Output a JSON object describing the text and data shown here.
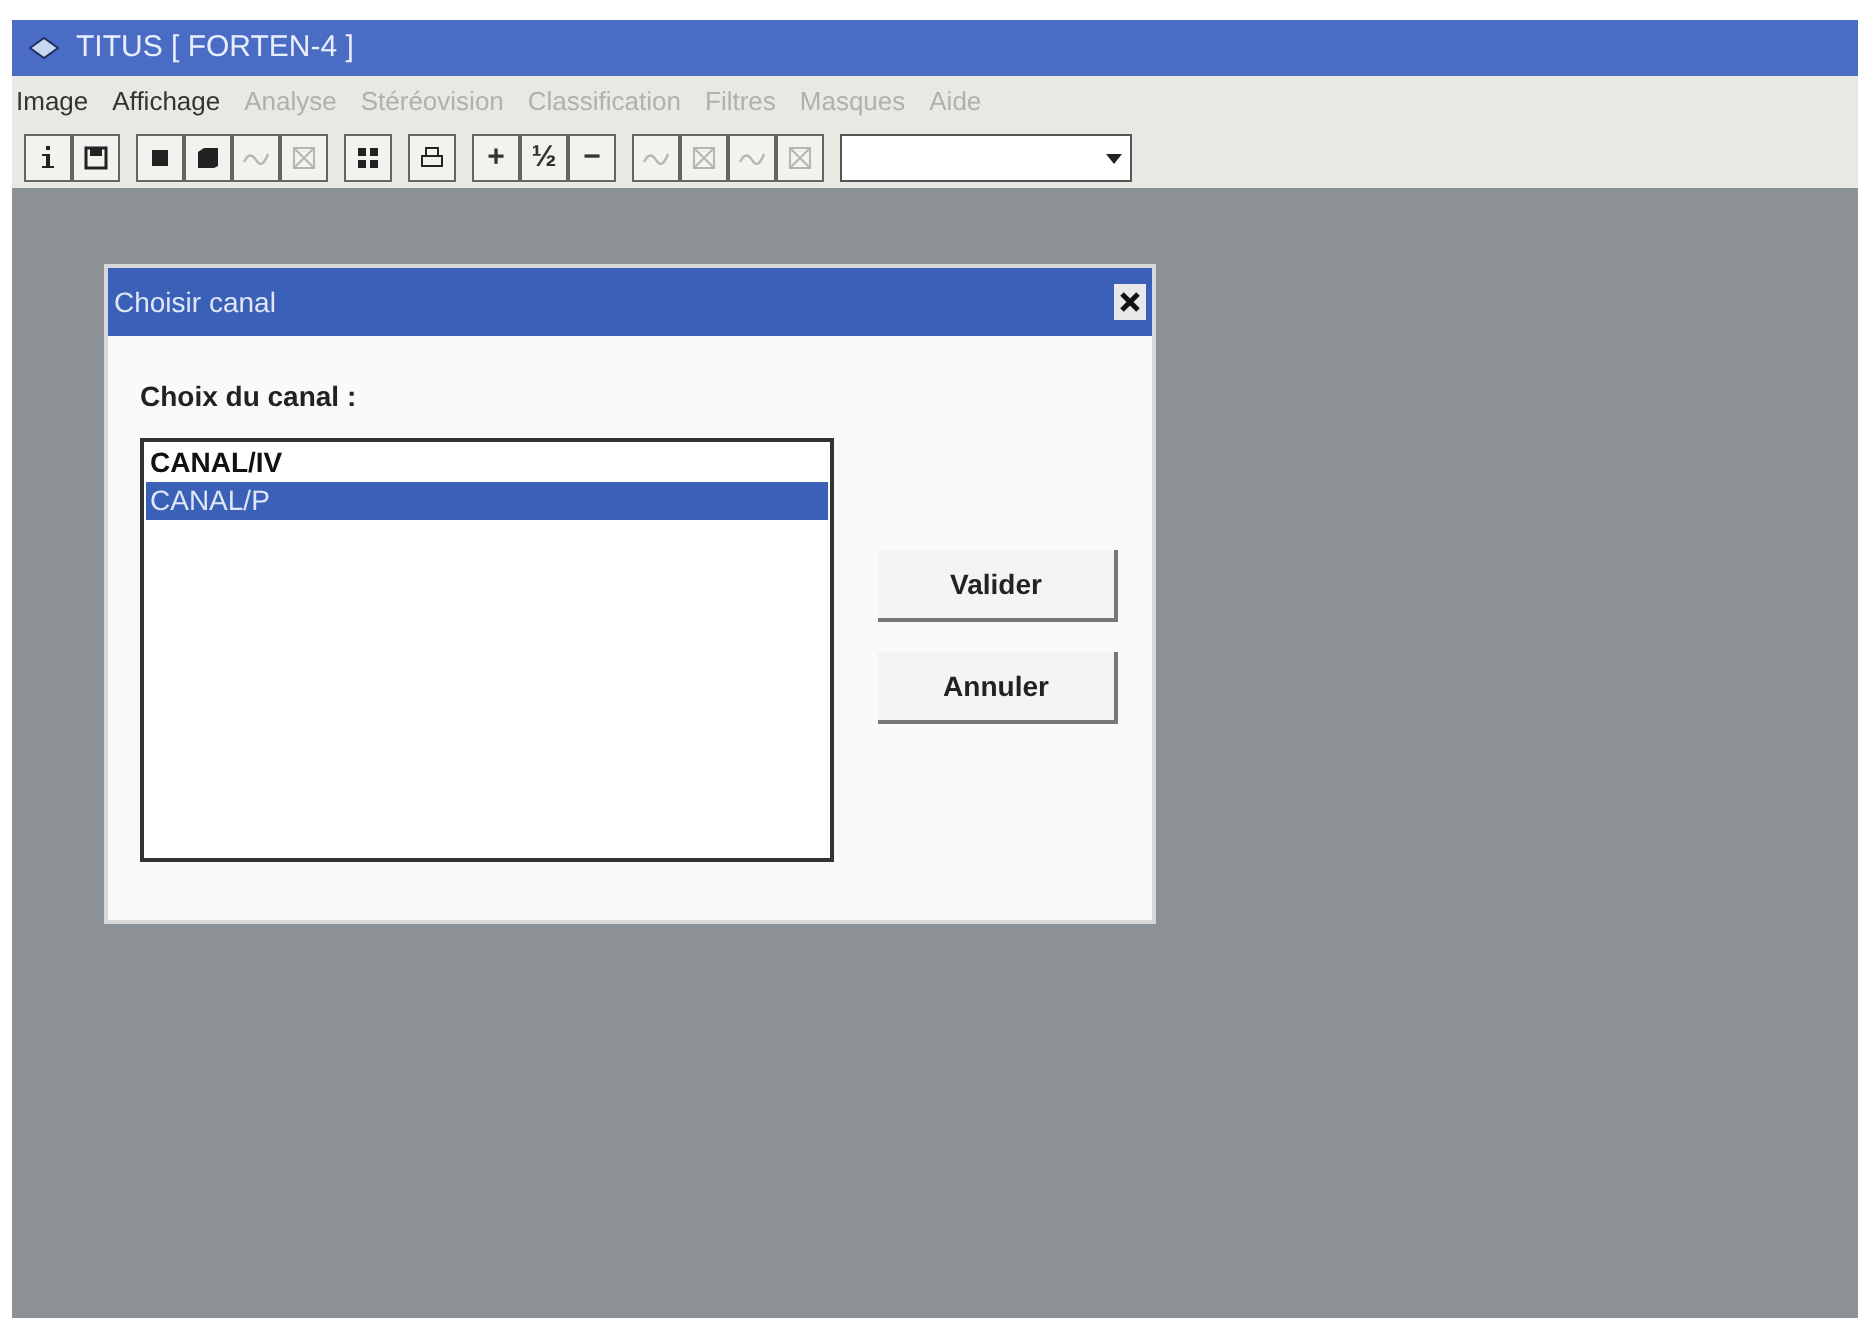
{
  "window": {
    "title": "TITUS [ FORTEN-4 ]"
  },
  "menu": [
    {
      "label": "Image",
      "disabled": false
    },
    {
      "label": "Affichage",
      "disabled": false
    },
    {
      "label": "Analyse",
      "disabled": true
    },
    {
      "label": "Stéréovision",
      "disabled": true
    },
    {
      "label": "Classification",
      "disabled": true
    },
    {
      "label": "Filtres",
      "disabled": true
    },
    {
      "label": "Masques",
      "disabled": true
    },
    {
      "label": "Aide",
      "disabled": true
    }
  ],
  "toolbar": [
    [
      {
        "kind": "info",
        "disabled": false
      },
      {
        "kind": "save",
        "disabled": false
      }
    ],
    [
      {
        "kind": "square",
        "disabled": false
      },
      {
        "kind": "pages",
        "disabled": false
      },
      {
        "kind": "wave",
        "disabled": true
      },
      {
        "kind": "frame",
        "disabled": true
      }
    ],
    [
      {
        "kind": "grid",
        "disabled": false
      }
    ],
    [
      {
        "kind": "print",
        "disabled": false
      }
    ],
    [
      {
        "kind": "text",
        "text": "+",
        "disabled": false
      },
      {
        "kind": "text",
        "text": "½",
        "disabled": false
      },
      {
        "kind": "text",
        "text": "−",
        "disabled": false
      }
    ],
    [
      {
        "kind": "wave",
        "disabled": true
      },
      {
        "kind": "frame",
        "disabled": true
      },
      {
        "kind": "wave",
        "disabled": true
      },
      {
        "kind": "frame",
        "disabled": true
      }
    ]
  ],
  "dialog": {
    "title": "Choisir canal",
    "label": "Choix du canal :",
    "channels": [
      {
        "label": "CANAL/IV",
        "selected": false
      },
      {
        "label": "CANAL/P",
        "selected": true
      }
    ],
    "buttons": [
      "Valider",
      "Annuler"
    ]
  }
}
